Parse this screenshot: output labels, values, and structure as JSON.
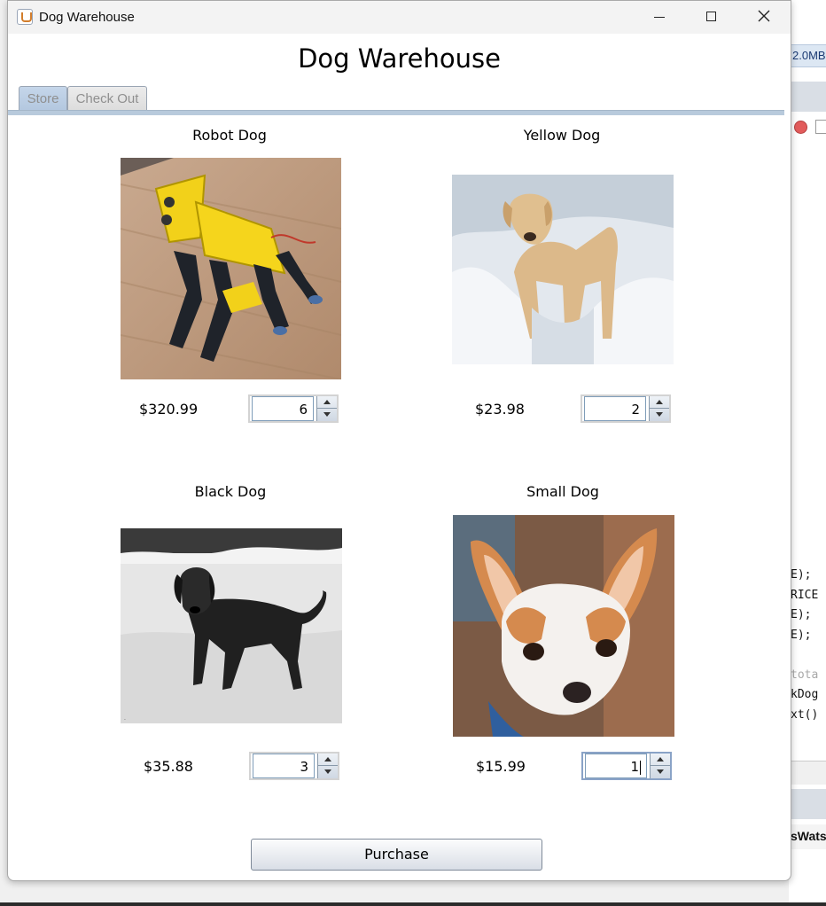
{
  "window": {
    "title": "Dog Warehouse"
  },
  "app": {
    "heading": "Dog Warehouse"
  },
  "tabs": [
    {
      "label": "Store",
      "selected": true
    },
    {
      "label": "Check Out",
      "selected": false
    }
  ],
  "products": [
    {
      "name": "Robot Dog",
      "price": "$320.99",
      "quantity": "6"
    },
    {
      "name": "Yellow Dog",
      "price": "$23.98",
      "quantity": "2"
    },
    {
      "name": "Black Dog",
      "price": "$35.88",
      "quantity": "3"
    },
    {
      "name": "Small Dog",
      "price": "$15.99",
      "quantity": "1"
    }
  ],
  "purchase_label": "Purchase",
  "background": {
    "memory_text": "2.0MB",
    "code_lines": [
      "E);",
      "RICE",
      "E);",
      "E);",
      "",
      "tota",
      "kDog",
      "xt()"
    ],
    "author_fragment": "sWats"
  }
}
